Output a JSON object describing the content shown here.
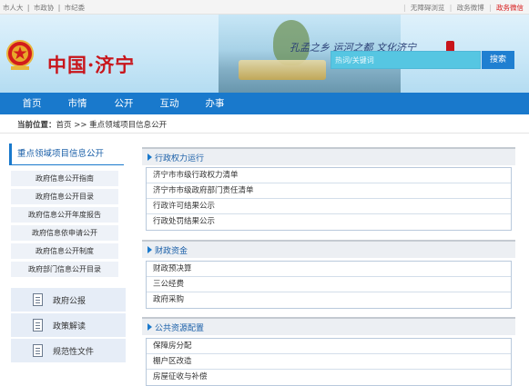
{
  "topbar": {
    "left_links": [
      "市人大",
      "|",
      "市政协",
      "|",
      "市纪委"
    ],
    "right_links": [
      "无障碍浏览",
      "政务微博",
      "政务微信"
    ]
  },
  "header": {
    "title": "中国·济宁",
    "slogan": "孔孟之乡 运河之都 文化济宁",
    "search_placeholder": "热词/关键词",
    "search_button": "搜索"
  },
  "nav": {
    "items": [
      "首页",
      "市情",
      "公开",
      "互动",
      "办事"
    ]
  },
  "breadcrumb": {
    "label": "当前位置：",
    "path": "首页 >> 重点领域项目信息公开"
  },
  "sidebar": {
    "title": "重点领域项目信息公开",
    "links": [
      "政府信息公开指南",
      "政府信息公开目录",
      "政府信息公开年度报告",
      "政府信息依申请公开",
      "政府信息公开制度",
      "政府部门信息公开目录"
    ],
    "cards": [
      {
        "label": "政府公报",
        "icon": "gazette-icon"
      },
      {
        "label": "政策解读",
        "icon": "policy-icon"
      },
      {
        "label": "规范性文件",
        "icon": "document-icon"
      }
    ]
  },
  "sections": [
    {
      "title": "行政权力运行",
      "items": [
        "济宁市市级行政权力清单",
        "济宁市市级政府部门责任清单",
        "行政许可结果公示",
        "行政处罚结果公示"
      ]
    },
    {
      "title": "财政资金",
      "items": [
        "财政预决算",
        "三公经费",
        "政府采购"
      ]
    },
    {
      "title": "公共资源配置",
      "items": [
        "保障房分配",
        "棚户区改造",
        "房屋征收与补偿"
      ]
    }
  ],
  "colors": {
    "brand_red": "#c8151b",
    "nav_blue": "#1979cc",
    "search_cyan": "#56c6e2"
  }
}
